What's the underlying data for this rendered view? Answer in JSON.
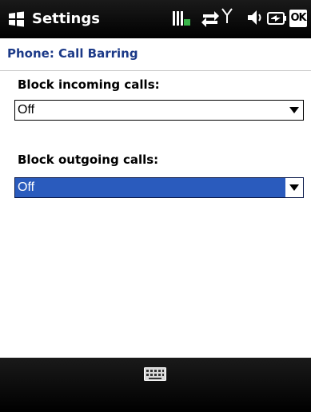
{
  "title_bar": {
    "title": "Settings",
    "ok_label": "OK",
    "icons": [
      "windows-start-icon",
      "signal-battery-icon",
      "connectivity-icon",
      "antenna-icon",
      "volume-icon",
      "battery-icon"
    ]
  },
  "page": {
    "title": "Phone: Call Barring"
  },
  "form": {
    "incoming": {
      "label": "Block incoming calls:",
      "value": "Off"
    },
    "outgoing": {
      "label": "Block outgoing calls:",
      "value": "Off",
      "selected": true
    }
  },
  "soft_keys": {
    "center_icon": "keyboard-icon"
  },
  "colors": {
    "title_bar_bg": "#000000",
    "page_title_color": "#1c3a88",
    "selection_color": "#2a5bbd"
  }
}
